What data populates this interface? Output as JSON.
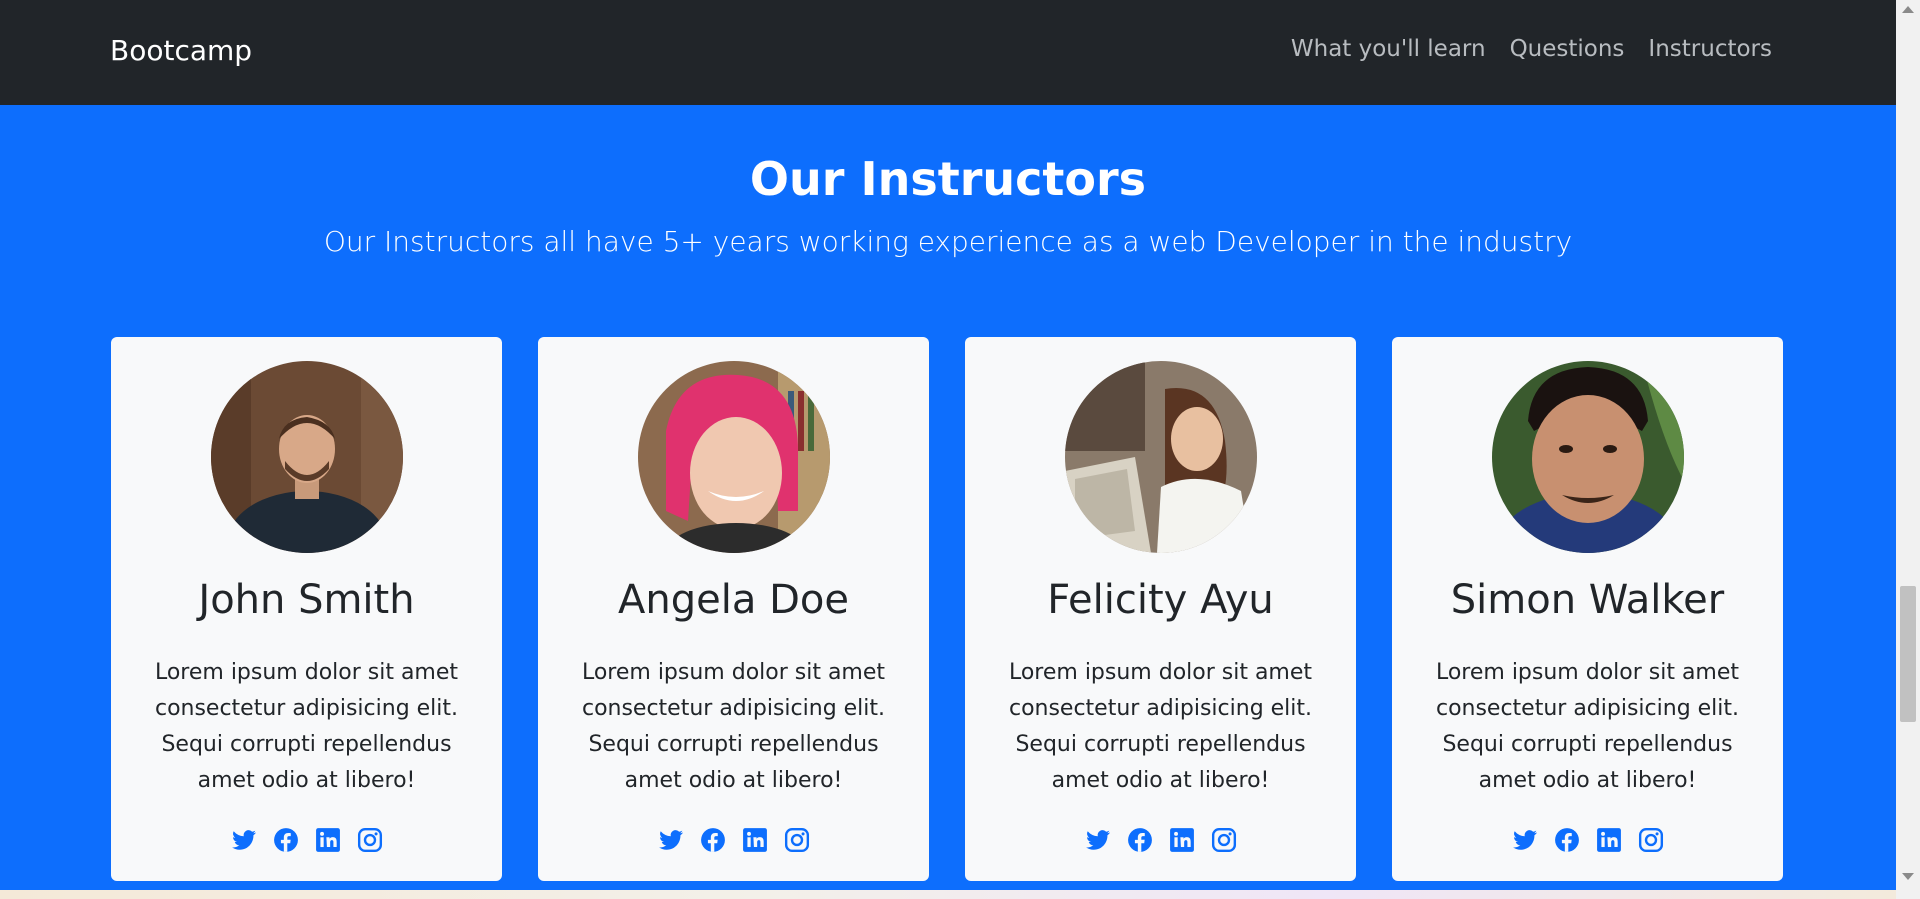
{
  "navbar": {
    "brand": "Bootcamp",
    "links": [
      "What you'll learn",
      "Questions",
      "Instructors"
    ]
  },
  "section": {
    "title": "Our Instructors",
    "subtitle": "Our Instructors all have 5+ years working experience as a web Developer in the industry"
  },
  "instructors": [
    {
      "name": "John Smith",
      "bio": "Lorem ipsum dolor sit amet consectetur adipisicing elit. Sequi corrupti repellendus amet odio at libero!"
    },
    {
      "name": "Angela Doe",
      "bio": "Lorem ipsum dolor sit amet consectetur adipisicing elit. Sequi corrupti repellendus amet odio at libero!"
    },
    {
      "name": "Felicity Ayu",
      "bio": "Lorem ipsum dolor sit amet consectetur adipisicing elit. Sequi corrupti repellendus amet odio at libero!"
    },
    {
      "name": "Simon Walker",
      "bio": "Lorem ipsum dolor sit amet consectetur adipisicing elit. Sequi corrupti repellendus amet odio at libero!"
    }
  ],
  "social_icons": [
    "twitter-icon",
    "facebook-icon",
    "linkedin-icon",
    "instagram-icon"
  ],
  "colors": {
    "navbar_bg": "#212529",
    "primary": "#0d6efd",
    "card_bg": "#f8f9fa",
    "text_dark": "#212529"
  }
}
